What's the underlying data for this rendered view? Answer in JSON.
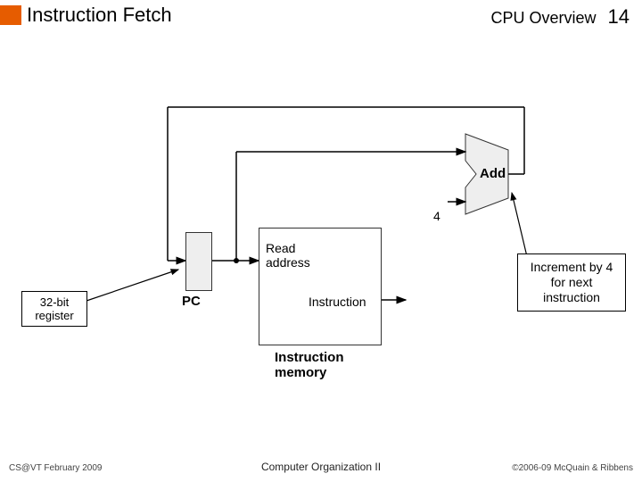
{
  "header": {
    "title": "Instruction Fetch",
    "section": "CPU Overview",
    "page": "14"
  },
  "diagram": {
    "pc_label": "PC",
    "read_address": "Read\naddress",
    "instruction_out": "Instruction",
    "memory_name": "Instruction\nmemory",
    "adder_label": "Add",
    "constant_four": "4"
  },
  "annotations": {
    "increment_note": "Increment by 4 for next instruction",
    "register_note": "32-bit register"
  },
  "footer": {
    "left": "CS@VT February 2009",
    "center": "Computer Organization II",
    "right": "©2006-09  McQuain & Ribbens"
  }
}
